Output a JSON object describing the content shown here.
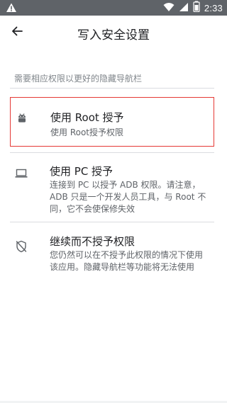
{
  "status_bar": {
    "time": "2:33",
    "left_icon": "warning-icon",
    "right_icons": [
      "wifi-icon",
      "signal-icon",
      "battery-icon"
    ]
  },
  "app_bar": {
    "title": "写入安全设置",
    "back_icon": "arrow-back-icon"
  },
  "hint": "需要相应权限以更好的隐藏导航栏",
  "options": [
    {
      "icon": "android-icon",
      "title": "使用 Root 授予",
      "description": "使用 Root授予权限",
      "highlighted": true
    },
    {
      "icon": "laptop-icon",
      "title": "使用 PC 授予",
      "description": "连接到 PC 以授予 ADB 权限。请注意，ADB 只是一个开发人员工具，与 Root 不同，它不会使保修失效"
    },
    {
      "icon": "shield-off-icon",
      "title": "继续而不授予权限",
      "description": "您仍然可以在不授予此权限的情况下使用该应用。隐藏导航栏等功能将无法使用"
    }
  ],
  "colors": {
    "status_bar": "#5f6368",
    "highlight_border": "#e53935",
    "divider": "#dadce0",
    "secondary_text": "#5f6368",
    "hint_text": "#80868b"
  }
}
